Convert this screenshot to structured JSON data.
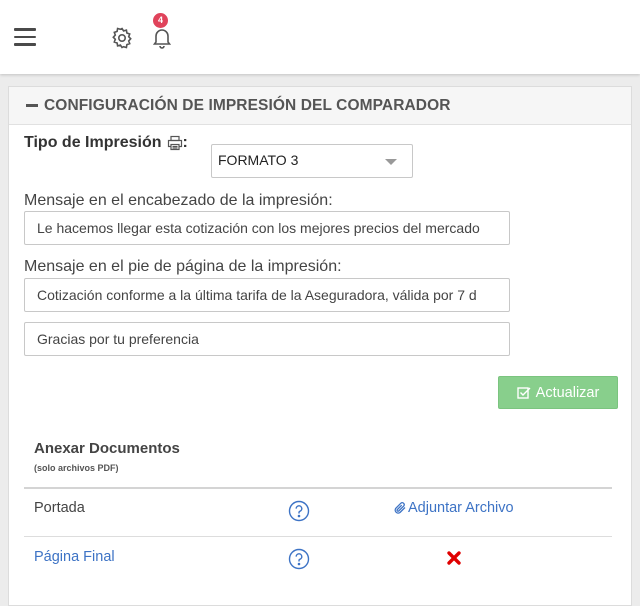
{
  "topbar": {
    "notifications_count": "4",
    "icons": [
      "menu-icon",
      "gear-icon",
      "bell-icon"
    ]
  },
  "panel": {
    "title": "CONFIGURACIÓN DE IMPRESIÓN DEL COMPARADOR",
    "print_type_label": "Tipo de Impresión",
    "print_type_icon": "printer-icon",
    "print_type_value": "FORMATO 3",
    "header_message_label": "Mensaje en el encabezado de la impresión:",
    "header_message_value": "Le hacemos llegar esta cotización con los mejores precios del mercado",
    "footer_message_label": "Mensaje en el pie de página de la impresión:",
    "footer_message_value_1": "Cotización conforme a la última tarifa de la Aseguradora, válida por 7 d",
    "footer_message_value_2": "Gracias por tu preferencia",
    "update_button": "Actualizar"
  },
  "annex": {
    "title": "Anexar Documentos",
    "subtitle": "(solo archivos PDF)",
    "rows": [
      {
        "label": "Portada",
        "action": "Adjuntar Archivo",
        "action_icon": "paperclip-icon"
      },
      {
        "label": "Página Final",
        "action_icon": "remove-icon"
      }
    ]
  },
  "colors": {
    "accent_link": "#3d73c5",
    "button_green": "#88cf8c",
    "badge_red": "#e0435b",
    "remove_red": "#e00000"
  }
}
